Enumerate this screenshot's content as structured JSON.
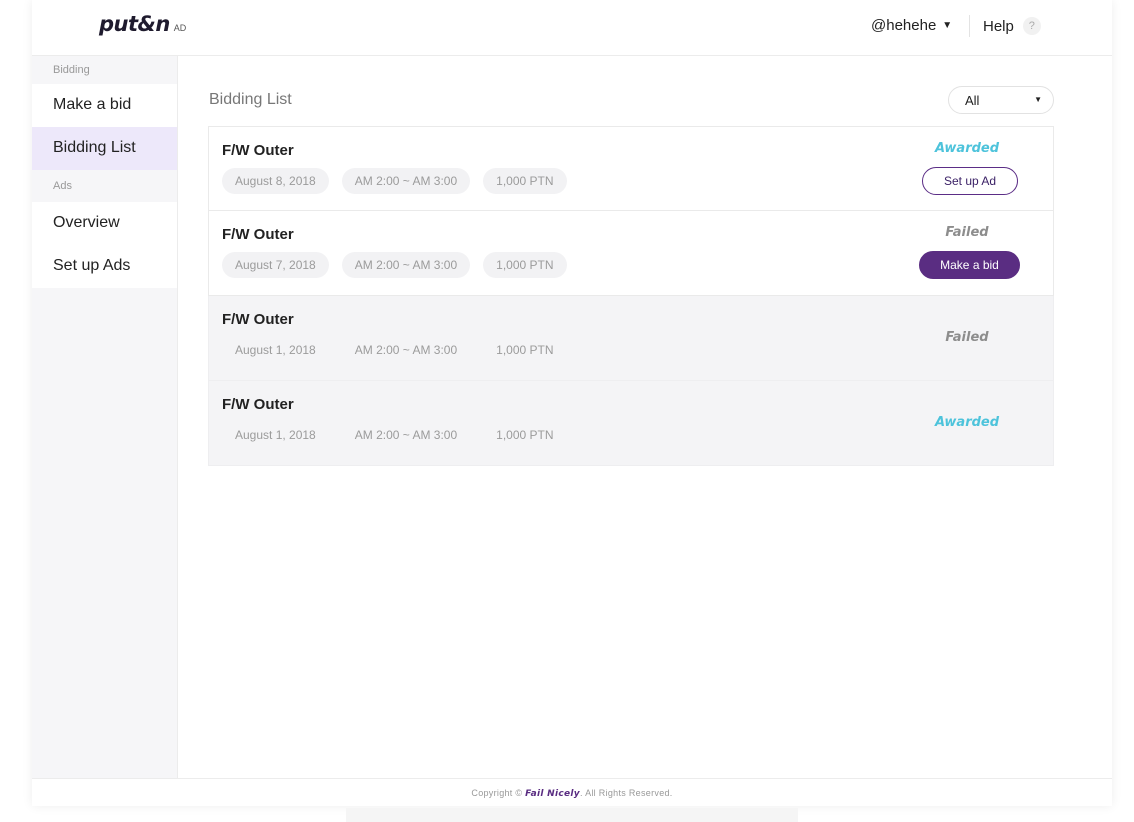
{
  "header": {
    "logo_text": "put&n",
    "logo_sub": "AD",
    "user": "@hehehe",
    "caret": "▼",
    "help_label": "Help",
    "help_badge": "?"
  },
  "sidebar": {
    "groups": [
      {
        "label": "Bidding",
        "items": [
          {
            "label": "Make a bid"
          },
          {
            "label": "Bidding List",
            "active": true
          }
        ]
      },
      {
        "label": "Ads",
        "items": [
          {
            "label": "Overview"
          },
          {
            "label": "Set up Ads"
          }
        ]
      }
    ]
  },
  "main": {
    "title": "Bidding List",
    "filter": {
      "value": "All",
      "arrow": "▼"
    },
    "rows": [
      {
        "title": "F/W Outer",
        "date": "August 8, 2018",
        "time": "AM 2:00 ~ AM 3:00",
        "price": "1,000 PTN",
        "status": "Awarded",
        "action": "Set up Ad"
      },
      {
        "title": "F/W Outer",
        "date": "August 7, 2018",
        "time": "AM 2:00 ~ AM 3:00",
        "price": "1,000 PTN",
        "status": "Failed",
        "action": "Make a bid"
      },
      {
        "title": "F/W Outer",
        "date": "August 1, 2018",
        "time": "AM 2:00 ~ AM 3:00",
        "price": "1,000 PTN",
        "status": "Failed"
      },
      {
        "title": "F/W Outer",
        "date": "August 1, 2018",
        "time": "AM 2:00 ~ AM 3:00",
        "price": "1,000 PTN",
        "status": "Awarded"
      }
    ]
  },
  "footer": {
    "prefix": "Copyright ©",
    "brand": "Fail Nicely",
    "suffix": ". All Rights Reserved."
  },
  "colors": {
    "accent": "#5a2d82",
    "awarded": "#4dc3db",
    "failed": "#8d8d8d",
    "active_nav": "#ede8fa"
  }
}
